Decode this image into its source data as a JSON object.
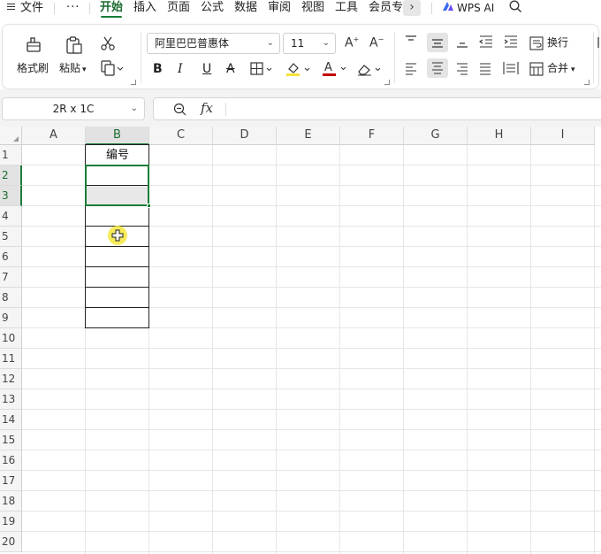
{
  "menu": {
    "file": "文件",
    "more": "···",
    "tabs": [
      "开始",
      "插入",
      "页面",
      "公式",
      "数据",
      "审阅",
      "视图",
      "工具",
      "会员专"
    ],
    "active_tab": "开始",
    "wps_ai": "WPS AI"
  },
  "ribbon": {
    "format_painter": "格式刷",
    "paste": "粘贴",
    "font_name": "阿里巴巴普惠体",
    "font_size": "11",
    "bold": "B",
    "italic": "I",
    "underline": "U",
    "strikethrough": "A",
    "wrap_text": "换行",
    "merge": "合并",
    "font_color": "#c00000",
    "fill_color": "#f5e23a"
  },
  "formula_bar": {
    "name_box": "2R x 1C",
    "fx": "fx",
    "value": ""
  },
  "sheet": {
    "columns": [
      "A",
      "B",
      "C",
      "D",
      "E",
      "F",
      "G",
      "H",
      "I"
    ],
    "rows": [
      "1",
      "2",
      "3",
      "4",
      "5",
      "6",
      "7",
      "8",
      "9",
      "10",
      "11",
      "12",
      "13",
      "14",
      "15",
      "16",
      "17",
      "18",
      "19",
      "20"
    ],
    "selected_column": "B",
    "selected_rows": [
      "2",
      "3"
    ],
    "cells": {
      "B1": "编号"
    },
    "accent": "#1a7d39"
  }
}
